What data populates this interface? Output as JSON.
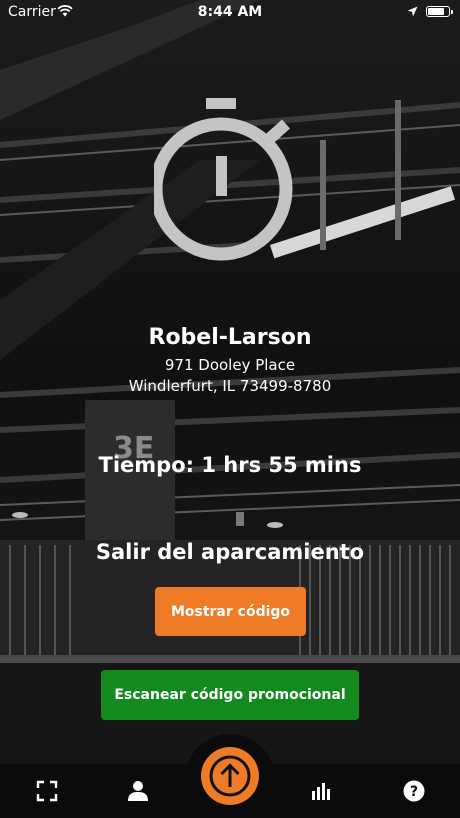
{
  "status_bar": {
    "carrier": "Carrier",
    "time": "8:44 AM",
    "battery_level": 0.85
  },
  "icons": {
    "stopwatch": "stopwatch-icon",
    "wifi": "wifi-icon",
    "location": "location-arrow-icon",
    "battery": "battery-icon",
    "tabs": [
      "scan-frame-icon",
      "user-icon",
      "upload-circle-icon",
      "bar-chart-icon",
      "help-circle-icon"
    ]
  },
  "location": {
    "name": "Robel-Larson",
    "address_line1": "971 Dooley Place",
    "address_line2": "Windlerfurt, IL 73499-8780"
  },
  "session": {
    "elapsed_label": "Tiempo: 1 hrs 55 mins",
    "exit_heading": "Salir del aparcamiento"
  },
  "actions": {
    "show_code_label": "Mostrar código",
    "scan_promo_label": "Escanear código promocional"
  },
  "colors": {
    "accent_orange": "#ef7b26",
    "promo_green": "#138a1e",
    "stopwatch_gray": "#c4c4c4",
    "tabbar_bg": "#0b0b0b"
  }
}
